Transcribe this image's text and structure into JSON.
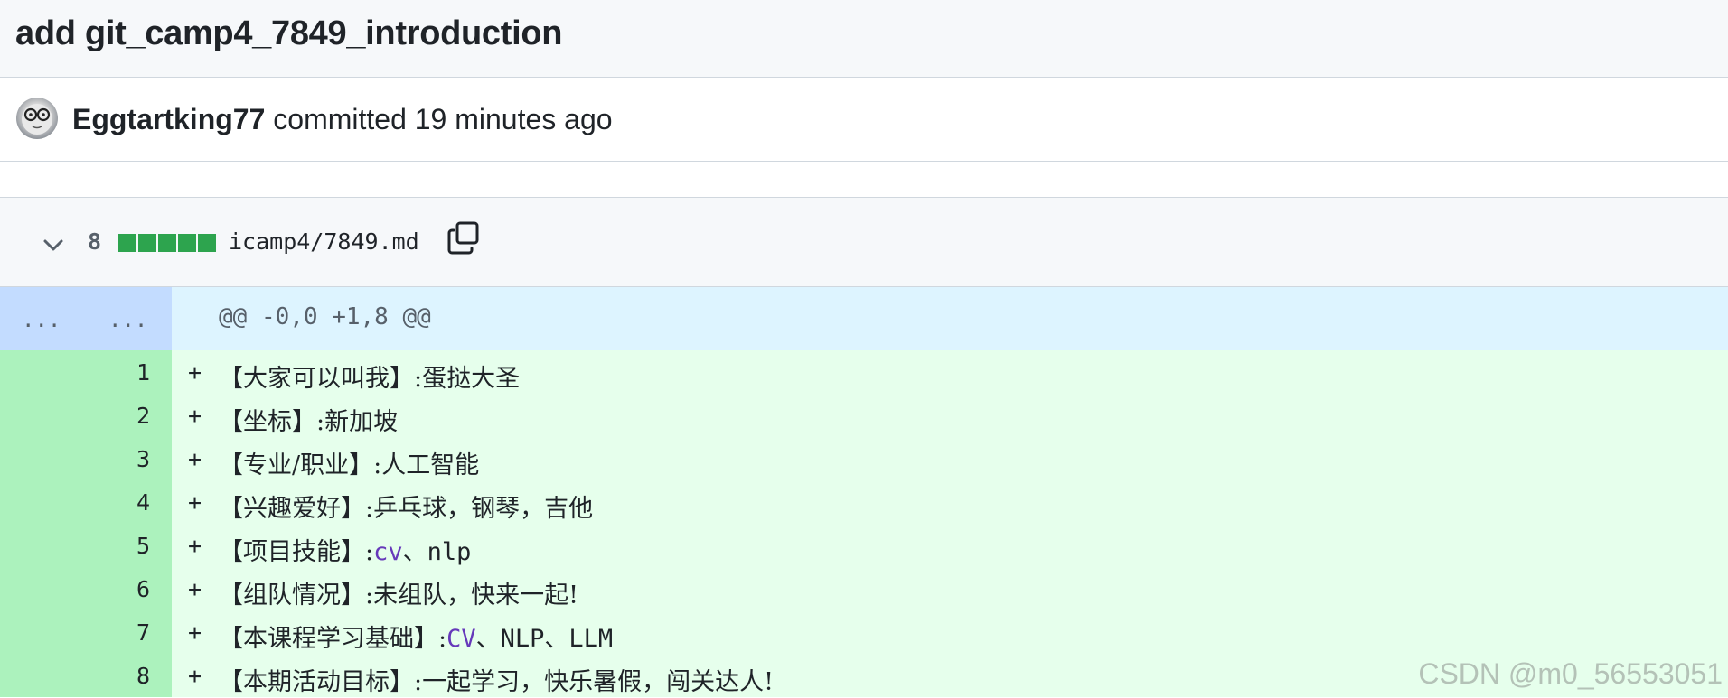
{
  "commit": {
    "title": "add git_camp4_7849_introduction",
    "author": "Eggtartking77",
    "verb": "committed",
    "time": "19 minutes ago"
  },
  "file": {
    "change_count": "8",
    "path": "icamp4/7849.md",
    "diffstat_added_blocks": 5
  },
  "hunk": {
    "left_dots": "...",
    "right_dots": "...",
    "header": "@@ -0,0 +1,8 @@"
  },
  "lines": [
    {
      "num": "1",
      "marker": "+",
      "prefix": "【大家可以叫我】:蛋挞大圣",
      "kw": "",
      "suffix": ""
    },
    {
      "num": "2",
      "marker": "+",
      "prefix": "【坐标】:新加坡",
      "kw": "",
      "suffix": ""
    },
    {
      "num": "3",
      "marker": "+",
      "prefix": "【专业/职业】:人工智能",
      "kw": "",
      "suffix": ""
    },
    {
      "num": "4",
      "marker": "+",
      "prefix": "【兴趣爱好】:乒乓球，钢琴，吉他",
      "kw": "",
      "suffix": ""
    },
    {
      "num": "5",
      "marker": "+",
      "prefix": "【项目技能】:",
      "kw": "cv",
      "suffix": "、nlp"
    },
    {
      "num": "6",
      "marker": "+",
      "prefix": "【组队情况】:未组队，快来一起!",
      "kw": "",
      "suffix": ""
    },
    {
      "num": "7",
      "marker": "+",
      "prefix": "【本课程学习基础】:",
      "kw": "CV",
      "suffix": "、NLP、LLM"
    },
    {
      "num": "8",
      "marker": "+",
      "prefix": "【本期活动目标】:一起学习，快乐暑假，闯关达人!",
      "kw": "",
      "suffix": ""
    }
  ],
  "icons": {
    "chevron": "chevron-down-icon",
    "copy": "copy-icon",
    "avatar": "avatar"
  },
  "colors": {
    "added_gutter": "#acf2bd",
    "added_code": "#e6ffec",
    "hunk_gutter": "#c3dcff",
    "hunk_code": "#ddf4ff",
    "diffstat": "#2da44e"
  },
  "watermark": "CSDN @m0_56553051"
}
